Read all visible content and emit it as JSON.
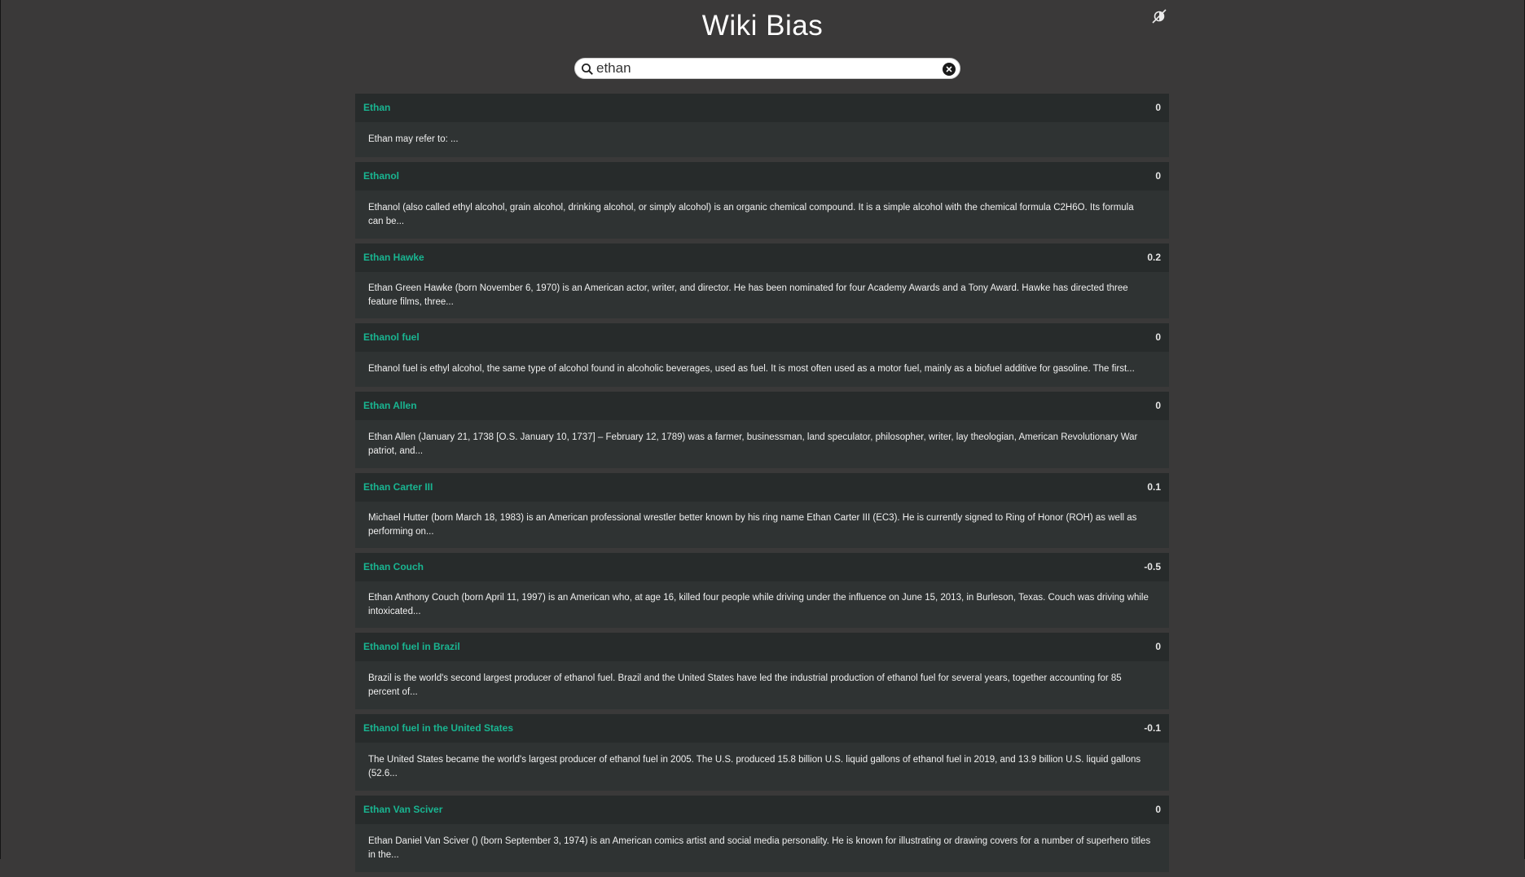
{
  "app": {
    "title": "Wiki Bias",
    "theme_toggle_icon": "theme-toggle-icon"
  },
  "search": {
    "value": "ethan",
    "icon": "search-icon",
    "clear_icon": "clear-icon"
  },
  "colors": {
    "background": "#3a3939",
    "accent": "#19b591",
    "card_header": "#272b2b",
    "card_body": "#2f3333"
  },
  "results": [
    {
      "title": "Ethan",
      "score": "0",
      "summary": "Ethan may refer to: ..."
    },
    {
      "title": "Ethanol",
      "score": "0",
      "summary": "Ethanol (also called ethyl alcohol, grain alcohol, drinking alcohol, or simply alcohol) is an organic chemical compound. It is a simple alcohol with the chemical formula C2H6O. Its formula can be..."
    },
    {
      "title": "Ethan Hawke",
      "score": "0.2",
      "summary": "Ethan Green Hawke (born November 6, 1970) is an American actor, writer, and director. He has been nominated for four Academy Awards and a Tony Award. Hawke has directed three feature films, three..."
    },
    {
      "title": "Ethanol fuel",
      "score": "0",
      "summary": "Ethanol fuel is ethyl alcohol, the same type of alcohol found in alcoholic beverages, used as fuel. It is most often used as a motor fuel, mainly as a biofuel additive for gasoline. The first..."
    },
    {
      "title": "Ethan Allen",
      "score": "0",
      "summary": "Ethan Allen (January 21, 1738 [O.S. January 10, 1737] – February 12, 1789) was a farmer, businessman, land speculator, philosopher, writer, lay theologian, American Revolutionary War patriot, and..."
    },
    {
      "title": "Ethan Carter III",
      "score": "0.1",
      "summary": "Michael Hutter (born March 18, 1983) is an American professional wrestler better known by his ring name Ethan Carter III (EC3). He is currently signed to Ring of Honor (ROH) as well as performing on..."
    },
    {
      "title": "Ethan Couch",
      "score": "-0.5",
      "summary": "Ethan Anthony Couch (born April 11, 1997) is an American who, at age 16, killed four people while driving under the influence on June 15, 2013, in Burleson, Texas. Couch was driving while intoxicated..."
    },
    {
      "title": "Ethanol fuel in Brazil",
      "score": "0",
      "summary": "Brazil is the world's second largest producer of ethanol fuel. Brazil and the United States have led the industrial production of ethanol fuel for several years, together accounting for 85 percent of..."
    },
    {
      "title": "Ethanol fuel in the United States",
      "score": "-0.1",
      "summary": "The United States became the world's largest producer of ethanol fuel in 2005. The U.S. produced 15.8 billion U.S. liquid gallons of ethanol fuel in 2019, and 13.9 billion U.S. liquid gallons (52.6..."
    },
    {
      "title": "Ethan Van Sciver",
      "score": "0",
      "summary": "Ethan Daniel Van Sciver () (born September 3, 1974) is an American comics artist and social media personality. He is known for illustrating or drawing covers for a number of superhero titles in the..."
    }
  ]
}
